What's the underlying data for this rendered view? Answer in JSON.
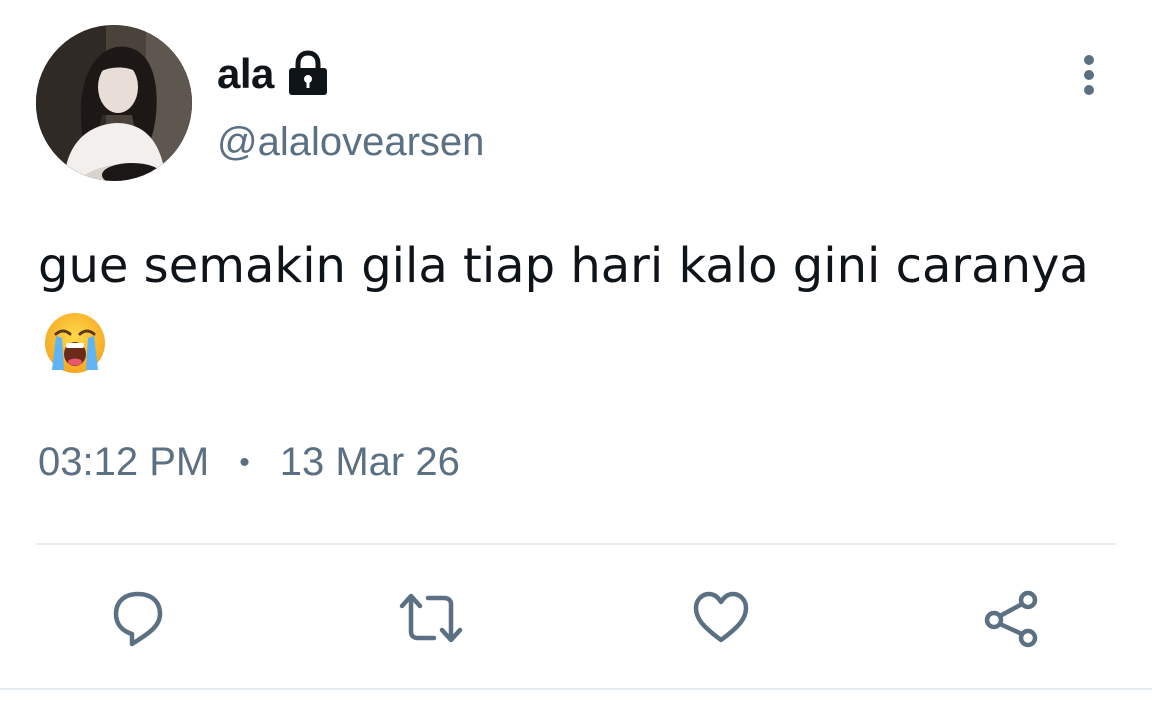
{
  "tweet": {
    "author": {
      "display_name": "ala",
      "handle": "@alalovearsen",
      "protected_icon": "lock-icon",
      "avatar": "profile-photo"
    },
    "text": "gue semakin gila tiap hari kalo gini caranya",
    "emoji": "loudly-crying-face",
    "time": "03:12 PM",
    "separator": "•",
    "date": "13 Mar 26",
    "menu_icon": "more-vertical-icon"
  },
  "actions": [
    {
      "name": "reply",
      "icon": "reply-icon"
    },
    {
      "name": "retweet",
      "icon": "retweet-icon"
    },
    {
      "name": "like",
      "icon": "heart-icon"
    },
    {
      "name": "share",
      "icon": "share-icon"
    }
  ],
  "colors": {
    "text_primary": "#0f1419",
    "text_secondary": "#5b7083",
    "divider": "#e6ecf0",
    "icon": "#5b7083"
  }
}
